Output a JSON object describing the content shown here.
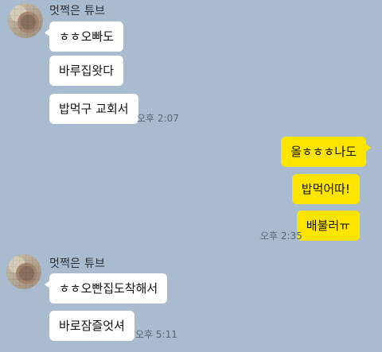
{
  "colors": {
    "chat_background": "#a9bccf",
    "incoming_bubble": "#ffffff",
    "outgoing_bubble": "#fee500",
    "timestamp_text": "#556574"
  },
  "groups": [
    {
      "sender": "멋쩍은 튜브",
      "messages": [
        "ㅎㅎ오빠도",
        "바루집왓다",
        "밥먹구 교회서"
      ],
      "time": "오후 2:07"
    },
    {
      "sender": "",
      "messages": [
        "올ㅎㅎㅎ나도",
        "밥먹어따!",
        "배불러ㅠ"
      ],
      "time": "오후 2:35"
    },
    {
      "sender": "멋쩍은 튜브",
      "messages": [
        "ㅎㅎ오빤집도착해서",
        "바로잠즐엇셔"
      ],
      "time": "오후 5:11"
    }
  ]
}
